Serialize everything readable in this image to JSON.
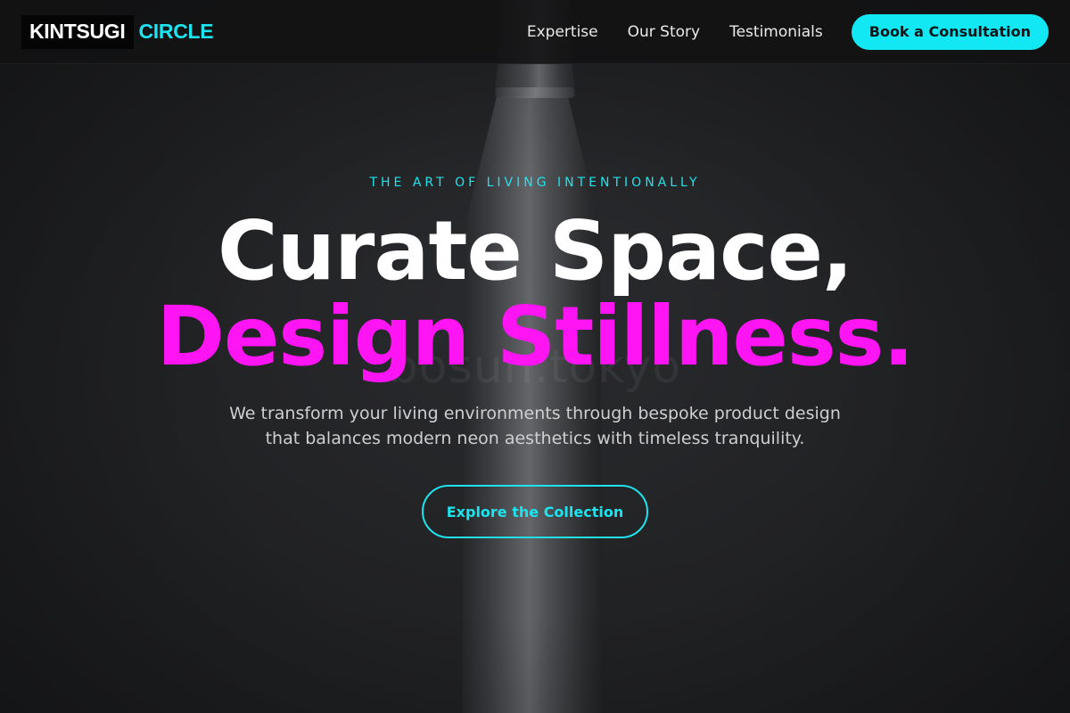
{
  "header": {
    "logo_primary": "KINTSUGI",
    "logo_accent": "CIRCLE",
    "nav": [
      {
        "label": "Expertise"
      },
      {
        "label": "Our Story"
      },
      {
        "label": "Testimonials"
      }
    ],
    "cta_label": "Book a Consultation"
  },
  "hero": {
    "eyebrow": "THE ART OF LIVING INTENTIONALLY",
    "headline_line1": "Curate Space,",
    "headline_line2": "Design Stillness.",
    "subtitle": "We transform your living environments through bespoke product design that balances modern neon aesthetics with timeless tranquility.",
    "button_label": "Explore the Collection",
    "watermark": "bosun.tokyo"
  },
  "colors": {
    "accent_cyan": "#1ee3ee",
    "accent_magenta": "#ff14f3",
    "background": "#1e1f21"
  }
}
